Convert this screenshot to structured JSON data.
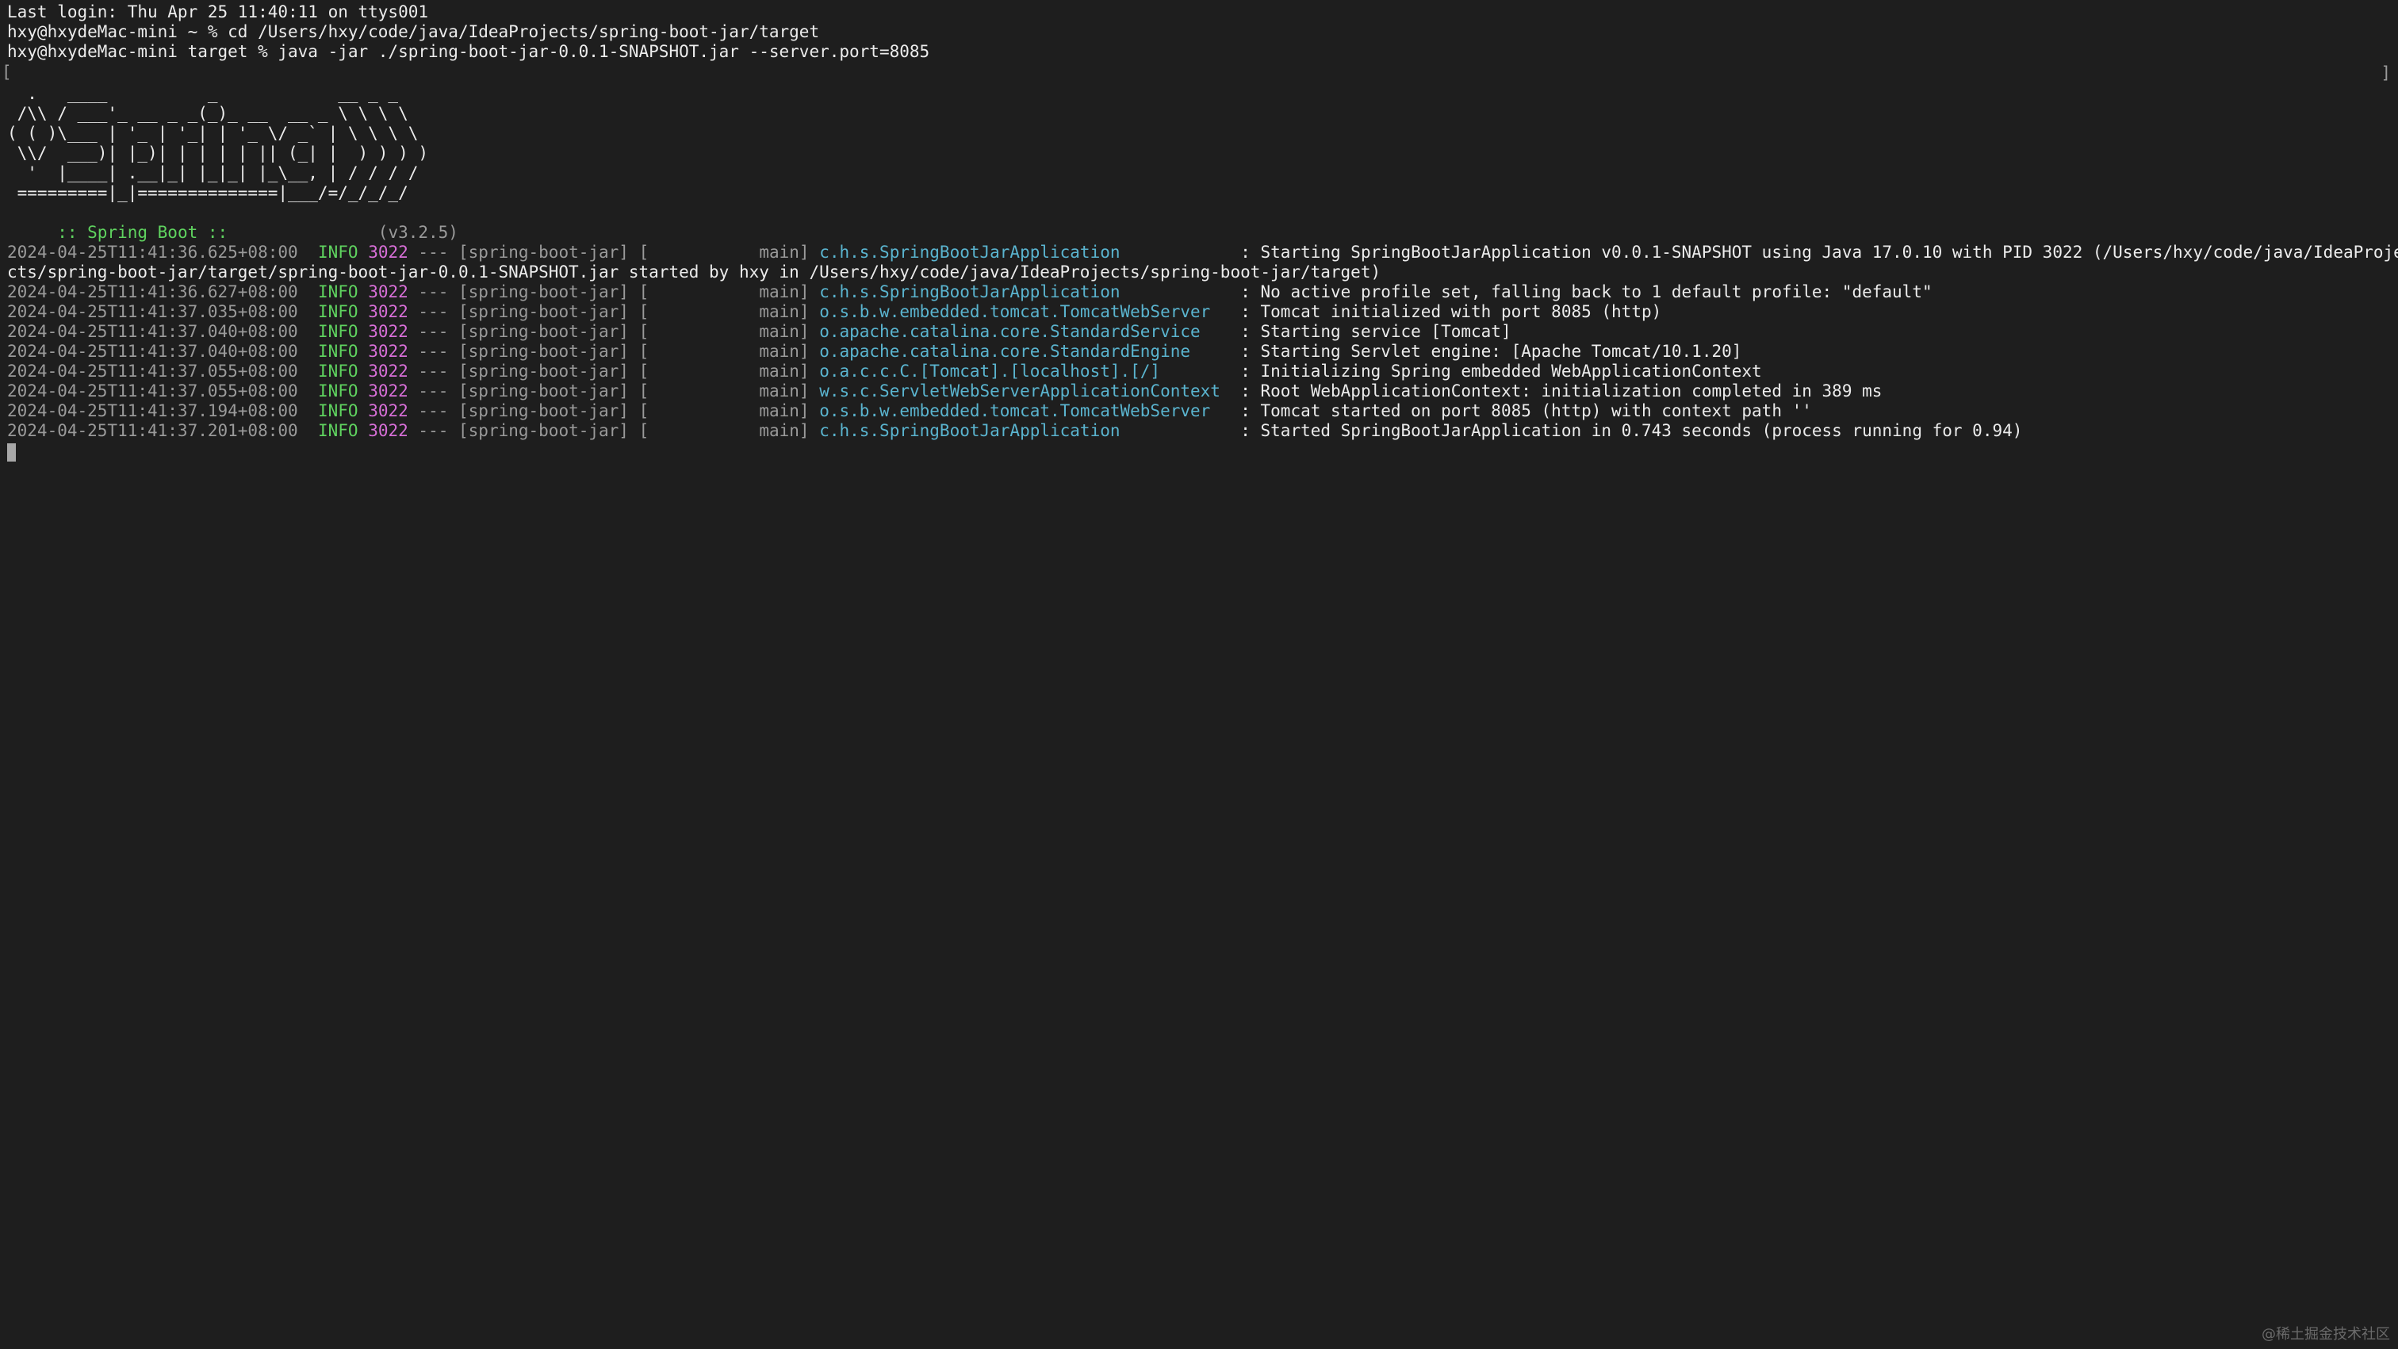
{
  "terminal": {
    "last_login": "Last login: Thu Apr 25 11:40:11 on ttys001",
    "cmd1": "hxy@hxydeMac-mini ~ % cd /Users/hxy/code/java/IdeaProjects/spring-boot-jar/target",
    "cmd2": "hxy@hxydeMac-mini target % java -jar ./spring-boot-jar-0.0.1-SNAPSHOT.jar --server.port=8085",
    "bracket_left": "[",
    "bracket_right": "]",
    "banner": [
      "  .   ____          _            __ _ _",
      " /\\\\ / ___'_ __ _ _(_)_ __  __ _ \\ \\ \\ \\",
      "( ( )\\___ | '_ | '_| | '_ \\/ _` | \\ \\ \\ \\",
      " \\\\/  ___)| |_)| | | | | || (_| |  ) ) ) )",
      "  '  |____| .__|_| |_|_| |_\\__, | / / / /",
      " =========|_|==============|___/=/_/_/_/"
    ],
    "spring_boot_label": " :: Spring Boot :: ",
    "spring_boot_version": "              (v3.2.5)",
    "logs": [
      {
        "timestamp": "2024-04-25T11:41:36.625+08:00",
        "level": "INFO",
        "pid": "3022",
        "sep": "---",
        "app": "[spring-boot-jar]",
        "thread": "[           main]",
        "logger": "c.h.s.SpringBootJarApplication           ",
        "message": ": Starting SpringBootJarApplication v0.0.1-SNAPSHOT using Java 17.0.10 with PID 3022 (/Users/hxy/code/java/IdeaProje"
      },
      {
        "timestamp": "2024-04-25T11:41:36.627+08:00",
        "level": "INFO",
        "pid": "3022",
        "sep": "---",
        "app": "[spring-boot-jar]",
        "thread": "[           main]",
        "logger": "c.h.s.SpringBootJarApplication           ",
        "message": ": No active profile set, falling back to 1 default profile: \"default\""
      },
      {
        "timestamp": "2024-04-25T11:41:37.035+08:00",
        "level": "INFO",
        "pid": "3022",
        "sep": "---",
        "app": "[spring-boot-jar]",
        "thread": "[           main]",
        "logger": "o.s.b.w.embedded.tomcat.TomcatWebServer  ",
        "message": ": Tomcat initialized with port 8085 (http)"
      },
      {
        "timestamp": "2024-04-25T11:41:37.040+08:00",
        "level": "INFO",
        "pid": "3022",
        "sep": "---",
        "app": "[spring-boot-jar]",
        "thread": "[           main]",
        "logger": "o.apache.catalina.core.StandardService   ",
        "message": ": Starting service [Tomcat]"
      },
      {
        "timestamp": "2024-04-25T11:41:37.040+08:00",
        "level": "INFO",
        "pid": "3022",
        "sep": "---",
        "app": "[spring-boot-jar]",
        "thread": "[           main]",
        "logger": "o.apache.catalina.core.StandardEngine    ",
        "message": ": Starting Servlet engine: [Apache Tomcat/10.1.20]"
      },
      {
        "timestamp": "2024-04-25T11:41:37.055+08:00",
        "level": "INFO",
        "pid": "3022",
        "sep": "---",
        "app": "[spring-boot-jar]",
        "thread": "[           main]",
        "logger": "o.a.c.c.C.[Tomcat].[localhost].[/]       ",
        "message": ": Initializing Spring embedded WebApplicationContext"
      },
      {
        "timestamp": "2024-04-25T11:41:37.055+08:00",
        "level": "INFO",
        "pid": "3022",
        "sep": "---",
        "app": "[spring-boot-jar]",
        "thread": "[           main]",
        "logger": "w.s.c.ServletWebServerApplicationContext ",
        "message": ": Root WebApplicationContext: initialization completed in 389 ms"
      },
      {
        "timestamp": "2024-04-25T11:41:37.194+08:00",
        "level": "INFO",
        "pid": "3022",
        "sep": "---",
        "app": "[spring-boot-jar]",
        "thread": "[           main]",
        "logger": "o.s.b.w.embedded.tomcat.TomcatWebServer  ",
        "message": ": Tomcat started on port 8085 (http) with context path ''"
      },
      {
        "timestamp": "2024-04-25T11:41:37.201+08:00",
        "level": "INFO",
        "pid": "3022",
        "sep": "---",
        "app": "[spring-boot-jar]",
        "thread": "[           main]",
        "logger": "c.h.s.SpringBootJarApplication           ",
        "message": ": Started SpringBootJarApplication in 0.743 seconds (process running for 0.94)"
      }
    ],
    "wrap_line": "cts/spring-boot-jar/target/spring-boot-jar-0.0.1-SNAPSHOT.jar started by hxy in /Users/hxy/code/java/IdeaProjects/spring-boot-jar/target)"
  },
  "watermark": "@稀土掘金技术社区",
  "colors": {
    "background": "#1e1e1e",
    "info": "#5fd35f",
    "pid": "#d86fd8",
    "logger": "#5ab4cf",
    "dim": "#9a9a9a"
  }
}
